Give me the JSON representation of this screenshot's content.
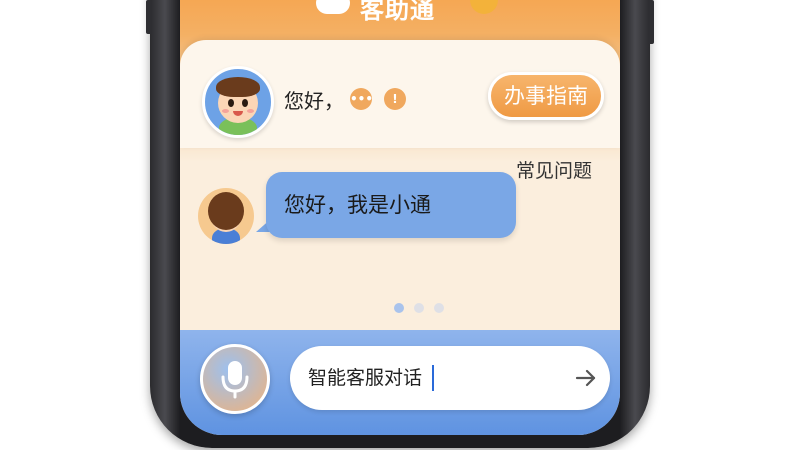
{
  "header": {
    "title": "客助通"
  },
  "welcome": {
    "greeting": "您好，"
  },
  "buttons": {
    "guide_label": "办事指南"
  },
  "faq": {
    "label": "常见问题"
  },
  "chat": {
    "message": "您好，我是小通"
  },
  "carousel": {
    "total": 3,
    "active": 1
  },
  "input": {
    "value": "智能客服对话"
  },
  "icons": {
    "more": "more-icon",
    "alert": "alert-icon",
    "mic": "mic-icon",
    "send": "arrow-right-icon"
  },
  "colors": {
    "accent_orange": "#f0a85e",
    "bubble_blue": "#7aa7e6",
    "bar_blue": "#5f93e1"
  }
}
